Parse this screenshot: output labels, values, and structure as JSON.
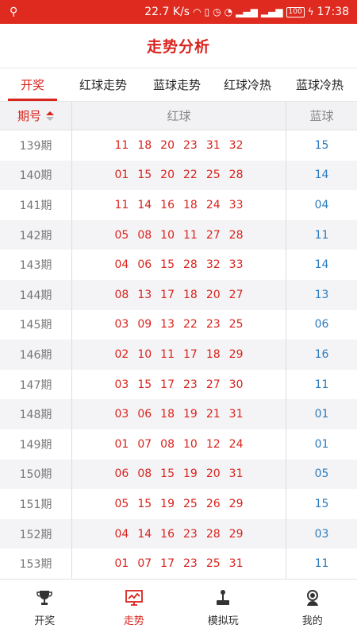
{
  "status": {
    "speed": "22.7 K/s",
    "battery": "100",
    "time": "17:38"
  },
  "header": {
    "title": "走势分析"
  },
  "tabs": [
    {
      "label": "开奖",
      "active": true
    },
    {
      "label": "红球走势",
      "active": false
    },
    {
      "label": "蓝球走势",
      "active": false
    },
    {
      "label": "红球冷热",
      "active": false
    },
    {
      "label": "蓝球冷热",
      "active": false
    }
  ],
  "table": {
    "headers": {
      "issue": "期号",
      "red": "红球",
      "blue": "蓝球"
    },
    "rows": [
      {
        "issue": "139期",
        "red": [
          "11",
          "18",
          "20",
          "23",
          "31",
          "32"
        ],
        "blue": "15"
      },
      {
        "issue": "140期",
        "red": [
          "01",
          "15",
          "20",
          "22",
          "25",
          "28"
        ],
        "blue": "14"
      },
      {
        "issue": "141期",
        "red": [
          "11",
          "14",
          "16",
          "18",
          "24",
          "33"
        ],
        "blue": "04"
      },
      {
        "issue": "142期",
        "red": [
          "05",
          "08",
          "10",
          "11",
          "27",
          "28"
        ],
        "blue": "11"
      },
      {
        "issue": "143期",
        "red": [
          "04",
          "06",
          "15",
          "28",
          "32",
          "33"
        ],
        "blue": "14"
      },
      {
        "issue": "144期",
        "red": [
          "08",
          "13",
          "17",
          "18",
          "20",
          "27"
        ],
        "blue": "13"
      },
      {
        "issue": "145期",
        "red": [
          "03",
          "09",
          "13",
          "22",
          "23",
          "25"
        ],
        "blue": "06"
      },
      {
        "issue": "146期",
        "red": [
          "02",
          "10",
          "11",
          "17",
          "18",
          "29"
        ],
        "blue": "16"
      },
      {
        "issue": "147期",
        "red": [
          "03",
          "15",
          "17",
          "23",
          "27",
          "30"
        ],
        "blue": "11"
      },
      {
        "issue": "148期",
        "red": [
          "03",
          "06",
          "18",
          "19",
          "21",
          "31"
        ],
        "blue": "01"
      },
      {
        "issue": "149期",
        "red": [
          "01",
          "07",
          "08",
          "10",
          "12",
          "24"
        ],
        "blue": "01"
      },
      {
        "issue": "150期",
        "red": [
          "06",
          "08",
          "15",
          "19",
          "20",
          "31"
        ],
        "blue": "05"
      },
      {
        "issue": "151期",
        "red": [
          "05",
          "15",
          "19",
          "25",
          "26",
          "29"
        ],
        "blue": "15"
      },
      {
        "issue": "152期",
        "red": [
          "04",
          "14",
          "16",
          "23",
          "28",
          "29"
        ],
        "blue": "03"
      },
      {
        "issue": "153期",
        "red": [
          "01",
          "07",
          "17",
          "23",
          "25",
          "31"
        ],
        "blue": "11"
      }
    ]
  },
  "bottom_nav": [
    {
      "label": "开奖",
      "icon": "trophy-icon",
      "active": false
    },
    {
      "label": "走势",
      "icon": "trend-chart-icon",
      "active": true
    },
    {
      "label": "模拟玩",
      "icon": "joystick-icon",
      "active": false
    },
    {
      "label": "我的",
      "icon": "profile-icon",
      "active": false
    }
  ],
  "colors": {
    "brand_red": "#d9231d",
    "blue_ball": "#2b7bbf"
  }
}
